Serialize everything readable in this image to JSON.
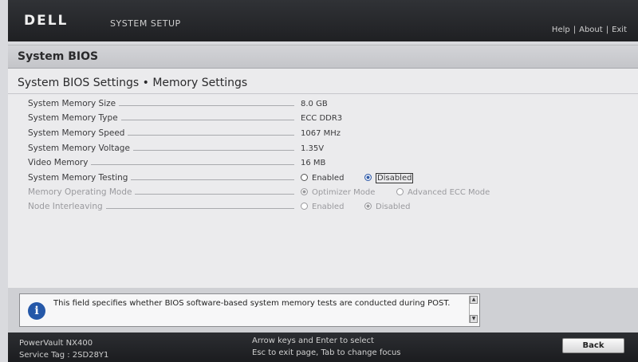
{
  "header": {
    "logo": "DELL",
    "app_title": "SYSTEM SETUP",
    "links": {
      "help": "Help",
      "about": "About",
      "exit": "Exit",
      "separator": "|"
    }
  },
  "panel": {
    "title": "System BIOS",
    "heading": "System BIOS Settings • Memory Settings"
  },
  "settings": [
    {
      "label": "System Memory Size",
      "value": "8.0 GB"
    },
    {
      "label": "System Memory Type",
      "value": "ECC DDR3"
    },
    {
      "label": "System Memory Speed",
      "value": "1067 MHz"
    },
    {
      "label": "System Memory Voltage",
      "value": "1.35V"
    },
    {
      "label": "Video Memory",
      "value": "16 MB"
    },
    {
      "label": "System Memory Testing",
      "options": [
        "Enabled",
        "Disabled"
      ],
      "selected": "Disabled",
      "enabled": true
    },
    {
      "label": "Memory Operating Mode",
      "options": [
        "Optimizer Mode",
        "Advanced ECC Mode"
      ],
      "selected": "Optimizer Mode",
      "enabled": false
    },
    {
      "label": "Node Interleaving",
      "options": [
        "Enabled",
        "Disabled"
      ],
      "selected": "Disabled",
      "enabled": false
    }
  ],
  "help": {
    "icon": "info-icon",
    "text": "This field specifies whether BIOS software-based system memory tests are conducted during POST."
  },
  "footer": {
    "model": "PowerVault NX400",
    "service_tag": "Service Tag : 2SD28Y1",
    "hint_line1": "Arrow keys and Enter to select",
    "hint_line2": "Esc to exit page, Tab to change focus",
    "back_label": "Back"
  },
  "colors": {
    "topbar": "#25272a",
    "panel_bg": "#ebebed",
    "info_icon": "#2558a8",
    "disabled_text": "#9a9a9e"
  }
}
